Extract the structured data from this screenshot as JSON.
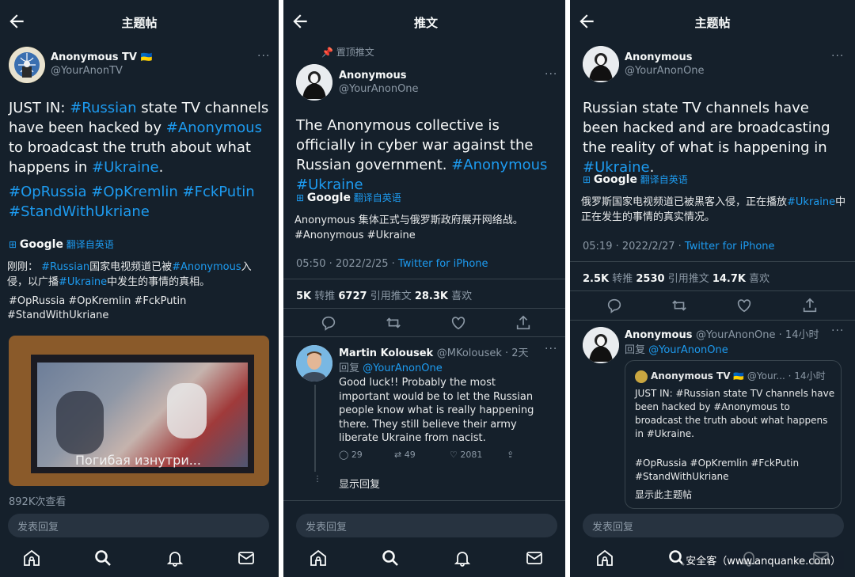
{
  "colors": {
    "bg": "#15202b",
    "accent": "#1d9bf0",
    "muted": "#8b98a5",
    "text": "#f7f9f9",
    "divider": "#38444d"
  },
  "panel1": {
    "title": "主题帖",
    "author_name": "Anonymous TV",
    "author_flag": "🇺🇦",
    "author_handle": "@YourAnonTV",
    "tweet": {
      "p1": "JUST IN: ",
      "t1": "#Russian",
      "p2": " state TV channels have been hacked by ",
      "t2": "#Anonymous",
      "p3": " to broadcast the truth about what happens in ",
      "t3": "#Ukraine",
      "p4": ".",
      "tags_line1": "#OpRussia #OpKremlin #FckPutin",
      "tags_line2": "#StandWithUkriane"
    },
    "google": "Google",
    "translate": "翻译自英语",
    "cn": {
      "a": "刚刚： ",
      "t1": "#Russian",
      "b": "国家电视频道已被",
      "t2": "#Anonymous",
      "c": "入侵，以广播",
      "t3": "#Ukraine",
      "d": "中发生的事情的真相。",
      "tags1": "#OpRussia #OpKremlin #FckPutin",
      "tags2": "#StandWithUkriane"
    },
    "video_caption": "Погибая изнутри...",
    "views": "892K次查看",
    "reply_placeholder": "发表回复"
  },
  "panel2": {
    "title": "推文",
    "pinned": "置顶推文",
    "author_name": "Anonymous",
    "author_handle": "@YourAnonOne",
    "tweet": {
      "p1": "The Anonymous collective is officially in cyber war against the Russian government. ",
      "t1": "#Anonymous #Ukraine"
    },
    "google": "Google",
    "translate": "翻译自英语",
    "cn": {
      "a": "Anonymous 集体正式与俄罗斯政府展开网络战。",
      "tags": "#Anonymous #Ukraine"
    },
    "time": "05:50 · 2022/2/25 · ",
    "source": "Twitter for iPhone",
    "stats": {
      "retweets": "5K",
      "retweets_label": " 转推  ",
      "quotes": "6727",
      "quotes_label": " 引用推文  ",
      "likes": "28.3K",
      "likes_label": " 喜欢"
    },
    "reply": {
      "name": "Martin Kolousek",
      "handle": "@MKolousek · 2天",
      "reply_to_label": "回复 ",
      "reply_to": "@YourAnonOne",
      "text": "Good luck!! Probably the most important would be to let the Russian people know what is really happening there. They still believe their army liberate Ukraine from nacist.",
      "replies": "29",
      "retweets": "49",
      "likes": "2081"
    },
    "show_replies": "显示回复",
    "reply_placeholder": "发表回复"
  },
  "panel3": {
    "title": "主题帖",
    "author_name": "Anonymous",
    "author_handle": "@YourAnonOne",
    "tweet": {
      "p1": "Russian state TV channels have been hacked and are broadcasting the reality of what is happening in ",
      "t1": "#Ukraine",
      "p2": "."
    },
    "google": "Google",
    "translate": "翻译自英语",
    "cn": {
      "a": "俄罗斯国家电视频道已被黑客入侵，正在播放",
      "t1": "#Ukraine",
      "b": "中正在发生的事情的真实情况。"
    },
    "time": "05:19 · 2022/2/27 · ",
    "source": "Twitter for iPhone",
    "stats": {
      "retweets": "2.5K",
      "retweets_label": " 转推  ",
      "quotes": "2530",
      "quotes_label": " 引用推文  ",
      "likes": "14.7K",
      "likes_label": " 喜欢"
    },
    "reply": {
      "name": "Anonymous",
      "handle": "@YourAnonOne · 14小时",
      "reply_to_label": "回复 ",
      "reply_to": "@YourAnonOne",
      "quote_name": "Anonymous TV",
      "quote_flag": "🇺🇦",
      "quote_handle": "@Your... · 14小时",
      "quote_text1": "JUST IN: #Russian state TV channels have been hacked by #Anonymous to broadcast the truth about what happens in #Ukraine.",
      "quote_text2": "#OpRussia #OpKremlin #FckPutin #StandWithUkriane",
      "show_thread": "显示此主题帖"
    },
    "reply_placeholder": "发表回复"
  },
  "watermark": "安全客（www.anquanke.com）",
  "icons": [
    "back-arrow-icon",
    "more-icon",
    "pin-icon",
    "google-translate-icon",
    "reply-icon",
    "retweet-icon",
    "like-icon",
    "share-icon",
    "home-icon",
    "search-icon",
    "notifications-icon",
    "messages-icon"
  ]
}
